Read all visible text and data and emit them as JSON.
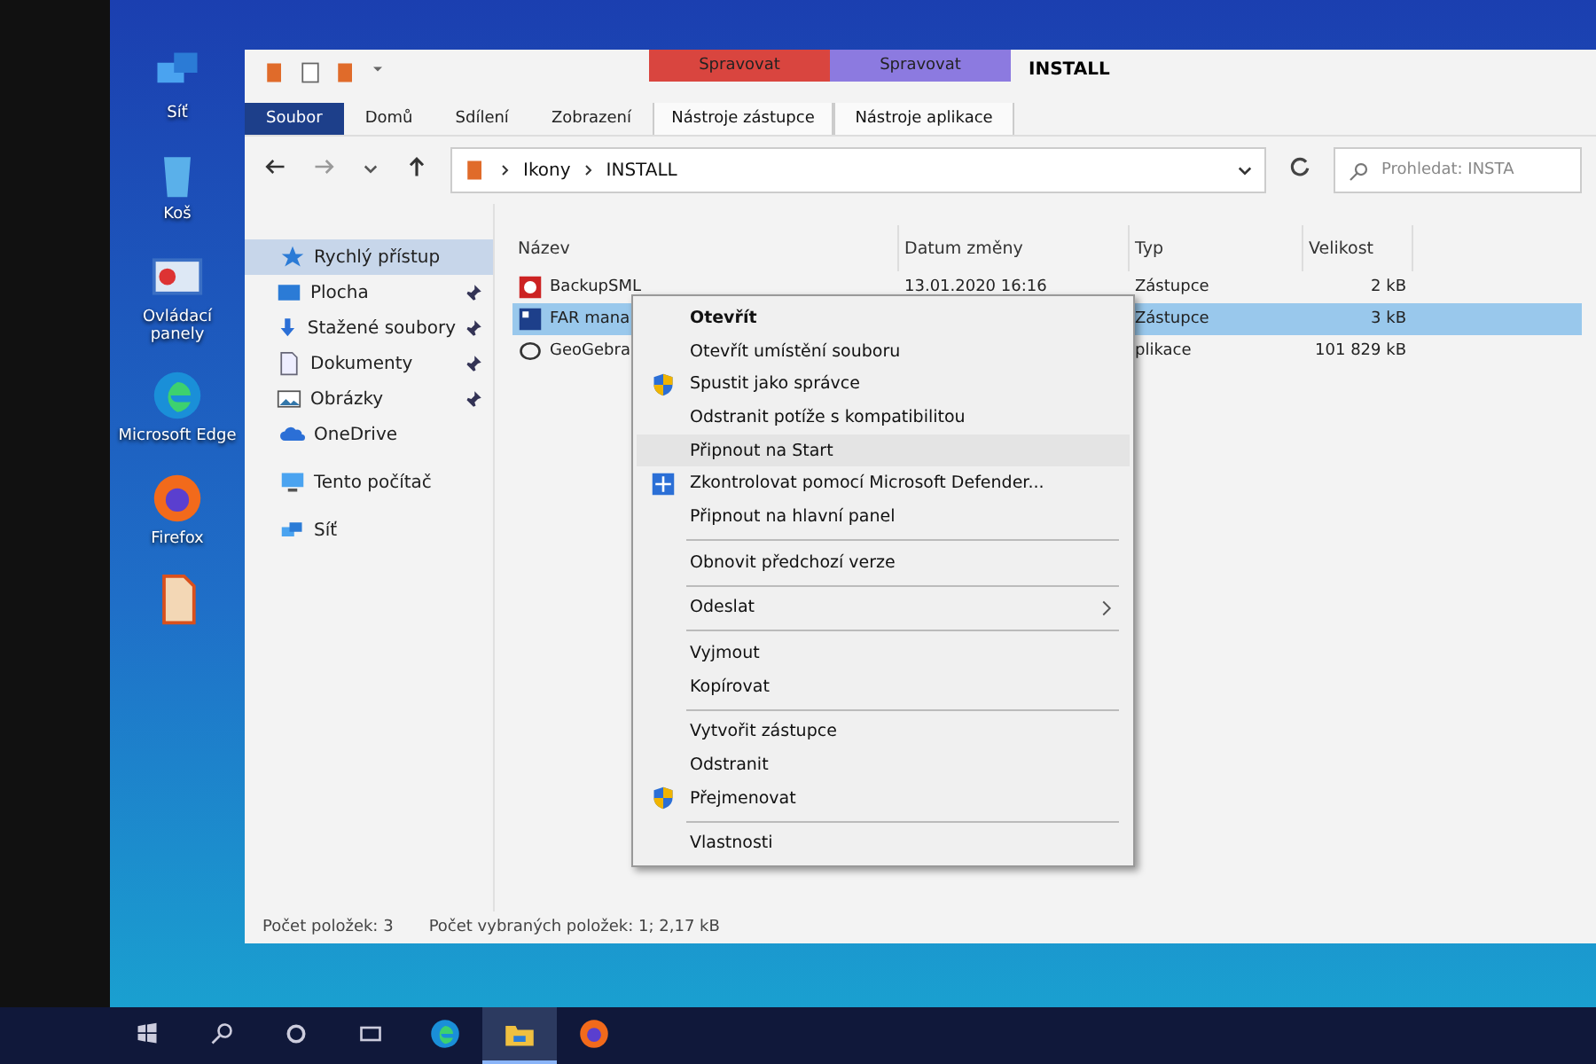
{
  "desktop_icons": [
    {
      "kind": "network",
      "label": "Síť"
    },
    {
      "kind": "bin",
      "label": "Koš"
    },
    {
      "kind": "panel",
      "label": "Ovládací panely"
    },
    {
      "kind": "edge",
      "label": "Microsoft Edge"
    },
    {
      "kind": "firefox",
      "label": "Firefox"
    },
    {
      "kind": "doc"
    }
  ],
  "window": {
    "title": "INSTALL",
    "context_tabs": [
      {
        "group": "Spravovat",
        "label": "Nástroje zástupce",
        "color": "#d9453f"
      },
      {
        "group": "Spravovat",
        "label": "Nástroje aplikace",
        "color": "#8c7ae0"
      }
    ],
    "ribbon_tabs": [
      {
        "label": "Soubor",
        "selected": true
      },
      {
        "label": "Domů",
        "selected": false
      },
      {
        "label": "Sdílení",
        "selected": false
      },
      {
        "label": "Zobrazení",
        "selected": false
      }
    ],
    "breadcrumb": [
      "Ikony",
      "INSTALL"
    ],
    "search": {
      "placeholder": "Prohledat: INSTA"
    },
    "nav": [
      {
        "label": "Rychlý přístup",
        "kind": "star",
        "selected": true,
        "children": [
          {
            "label": "Plocha",
            "kind": "desktop",
            "selected": false,
            "pinned": true
          },
          {
            "label": "Stažené soubory",
            "kind": "download",
            "selected": false,
            "pinned": true
          },
          {
            "label": "Dokumenty",
            "kind": "doc",
            "selected": false,
            "pinned": true
          },
          {
            "label": "Obrázky",
            "kind": "image",
            "selected": false,
            "pinned": true
          }
        ]
      },
      {
        "label": "OneDrive",
        "kind": "cloud",
        "selected": false
      },
      {
        "label": "Tento počítač",
        "kind": "pc",
        "selected": false
      },
      {
        "label": "Síť",
        "kind": "network",
        "selected": false
      }
    ],
    "columns": [
      "Název",
      "Datum změny",
      "Typ",
      "Velikost"
    ],
    "files": [
      {
        "name": "BackupSML",
        "date": "13.01.2020 16:16",
        "type": "Zástupce",
        "size": "2 kB",
        "selected": false,
        "kind": "backup"
      },
      {
        "name": "FAR mana",
        "type": "Zástupce",
        "size": "3 kB",
        "selected": true,
        "kind": "far"
      },
      {
        "name": "GeoGebra",
        "type": "plikace",
        "size": "101 829 kB",
        "selected": false,
        "kind": "geo"
      }
    ],
    "status": [
      "Počet položek: 3",
      "Počet vybraných položek: 1; 2,17 kB"
    ]
  },
  "context_menu": [
    {
      "label": "Otevřít",
      "bold": true,
      "kind": "plain",
      "hover": false,
      "submenu": false,
      "separator_before": false
    },
    {
      "label": "Otevřít umístění souboru",
      "bold": false,
      "kind": "plain",
      "hover": false,
      "submenu": false,
      "separator_before": false
    },
    {
      "label": "Spustit jako správce",
      "bold": false,
      "kind": "shield",
      "hover": false,
      "submenu": false,
      "separator_before": false
    },
    {
      "label": "Odstranit potíže s kompatibilitou",
      "bold": false,
      "kind": "plain",
      "hover": false,
      "submenu": false,
      "separator_before": false
    },
    {
      "label": "Připnout na Start",
      "bold": false,
      "kind": "plain",
      "hover": true,
      "submenu": false,
      "separator_before": false
    },
    {
      "label": "Zkontrolovat pomocí Microsoft Defender...",
      "bold": false,
      "kind": "defender",
      "hover": false,
      "submenu": false,
      "separator_before": false
    },
    {
      "label": "Připnout na hlavní panel",
      "bold": false,
      "kind": "plain",
      "hover": false,
      "submenu": false,
      "separator_before": false
    },
    {
      "label": "Obnovit předchozí verze",
      "bold": false,
      "kind": "plain",
      "hover": false,
      "submenu": false,
      "separator_before": true
    },
    {
      "label": "Odeslat",
      "bold": false,
      "kind": "plain",
      "hover": false,
      "submenu": true,
      "separator_before": true
    },
    {
      "label": "Vyjmout",
      "bold": false,
      "kind": "plain",
      "hover": false,
      "submenu": false,
      "separator_before": true
    },
    {
      "label": "Kopírovat",
      "bold": false,
      "kind": "plain",
      "hover": false,
      "submenu": false,
      "separator_before": false
    },
    {
      "label": "Vytvořit zástupce",
      "bold": false,
      "kind": "plain",
      "hover": false,
      "submenu": false,
      "separator_before": true
    },
    {
      "label": "Odstranit",
      "bold": false,
      "kind": "plain",
      "hover": false,
      "submenu": false,
      "separator_before": false
    },
    {
      "label": "Přejmenovat",
      "bold": false,
      "kind": "shield",
      "hover": false,
      "submenu": false,
      "separator_before": false
    },
    {
      "label": "Vlastnosti",
      "bold": false,
      "kind": "plain",
      "hover": false,
      "submenu": false,
      "separator_before": true
    }
  ],
  "taskbar": [
    {
      "kind": "start",
      "active": false
    },
    {
      "kind": "search",
      "active": false
    },
    {
      "kind": "cortana",
      "active": false
    },
    {
      "kind": "taskview",
      "active": false
    },
    {
      "kind": "edge",
      "active": false
    },
    {
      "kind": "explorer",
      "active": true
    },
    {
      "kind": "firefox",
      "active": false
    }
  ]
}
